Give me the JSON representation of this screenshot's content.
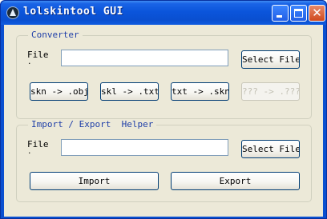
{
  "window": {
    "title": "lolskintool GUI",
    "icon": "lolskintool-icon",
    "controls": {
      "minimize": "minimize-icon",
      "maximize": "maximize-icon",
      "close": "close-icon",
      "close_glyph": "✕"
    }
  },
  "converter": {
    "legend": "Converter",
    "file_label": "File",
    "file_value": "",
    "select_file_label": "Select File",
    "buttons": [
      {
        "label": "skn -> .obj",
        "enabled": true
      },
      {
        "label": "skl -> .txt",
        "enabled": true
      },
      {
        "label": "txt -> .skn",
        "enabled": true
      },
      {
        "label": "??? -> .???",
        "enabled": false
      }
    ]
  },
  "helper": {
    "legend": "Import / Export  Helper",
    "file_label": "File",
    "file_value": "",
    "select_file_label": "Select File",
    "import_label": "Import",
    "export_label": "Export"
  },
  "colors": {
    "titlebar": "#0a4fd0",
    "client": "#ece9d8",
    "legend_text": "#1f3fa8",
    "button_border": "#003c74"
  }
}
